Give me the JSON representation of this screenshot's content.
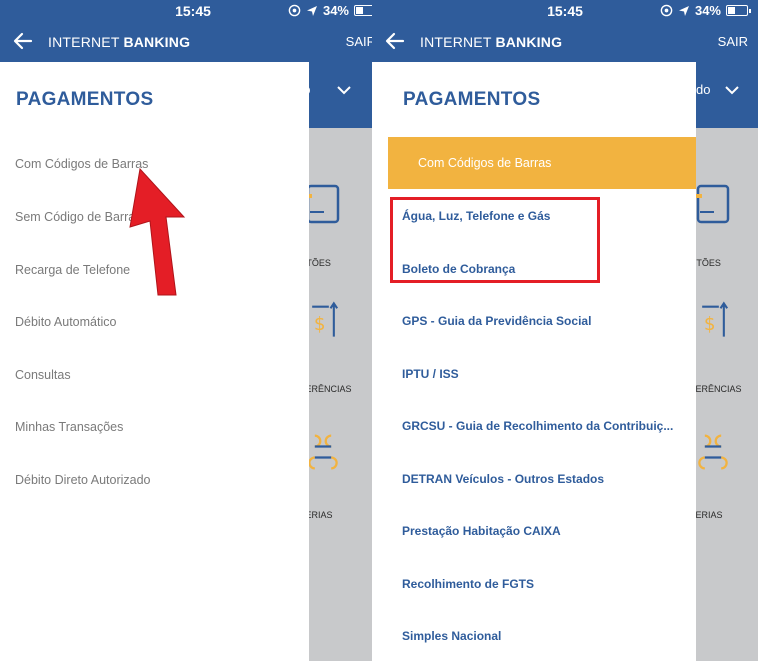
{
  "status": {
    "time": "15:45",
    "battery": "34%"
  },
  "appbar": {
    "title_a": "INTERNET ",
    "title_b": "BANKING",
    "logout": "SAIR"
  },
  "background": {
    "header_text": "do",
    "labels": [
      "RTÕES",
      "FERÊNCIAS",
      "TERIAS"
    ]
  },
  "left_drawer": {
    "title": "PAGAMENTOS",
    "items": [
      "Com Códigos de Barras",
      "Sem Código de Barras",
      "Recarga de Telefone",
      "Débito Automático",
      "Consultas",
      "Minhas Transações",
      "Débito Direto Autorizado"
    ]
  },
  "right_drawer": {
    "title": "PAGAMENTOS",
    "selected": "Com Códigos de Barras",
    "subitems": [
      "Água, Luz, Telefone e Gás",
      "Boleto de Cobrança",
      "GPS - Guia da Previdência Social",
      "IPTU / ISS",
      "GRCSU - Guia de Recolhimento da Contribuiç...",
      "DETRAN Veículos - Outros Estados",
      "Prestação Habitação CAIXA",
      "Recolhimento de FGTS",
      "Simples Nacional"
    ]
  },
  "colors": {
    "primary": "#2f5c9b",
    "accent": "#f2b340",
    "highlight": "#e41e26"
  },
  "icons": [
    "back-arrow-icon",
    "location-icon",
    "battery-icon",
    "chevron-down-icon",
    "card-icon",
    "transfer-icon",
    "clover-icon",
    "red-pointer-arrow"
  ]
}
